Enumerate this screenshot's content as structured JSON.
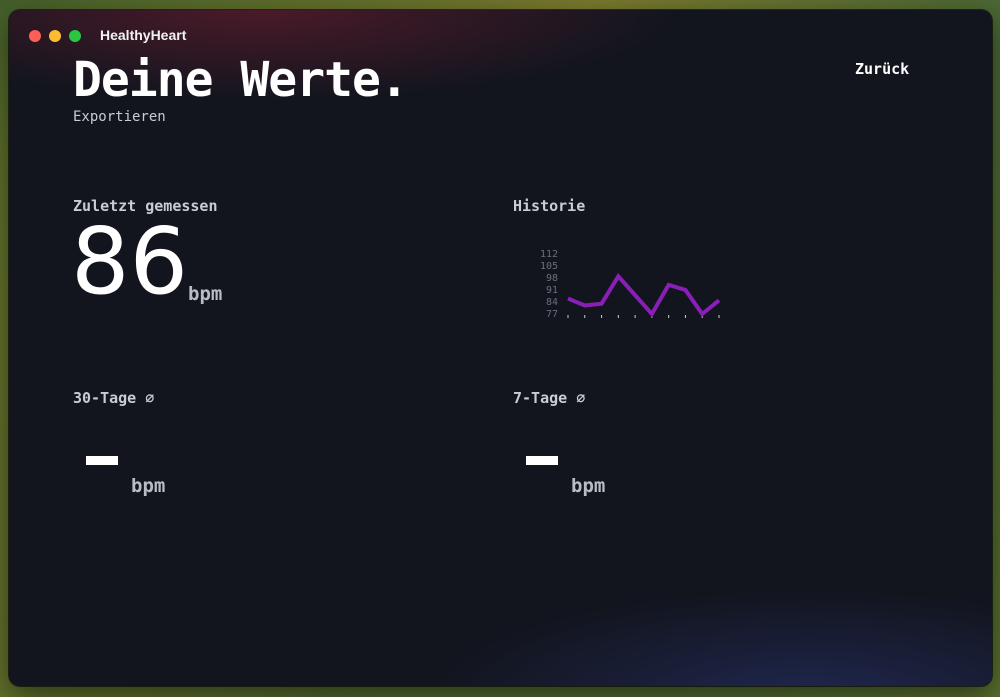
{
  "window": {
    "title": "HealthyHeart"
  },
  "header": {
    "title": "Deine Werte.",
    "export_label": "Exportieren",
    "back_label": "Zurück"
  },
  "latest": {
    "label": "Zuletzt gemessen",
    "value": "86",
    "unit": "bpm"
  },
  "history": {
    "label": "Historie"
  },
  "avg30": {
    "label": "30-Tage ⌀",
    "unit": "bpm"
  },
  "avg7": {
    "label": "7-Tage ⌀",
    "unit": "bpm"
  },
  "colors": {
    "accent": "#8a1fb8",
    "background": "#12151e"
  },
  "chart_data": {
    "type": "line",
    "x": [
      1,
      2,
      3,
      4,
      5,
      6,
      7,
      8,
      9,
      10
    ],
    "series": [
      {
        "values": [
          86,
          82,
          83,
          99,
          88,
          77,
          94,
          91,
          77,
          85
        ]
      }
    ],
    "yticks": [
      "112",
      "105",
      "98",
      "91",
      "84",
      "77"
    ],
    "ylim": [
      77,
      112
    ],
    "xlabel": "",
    "ylabel": "",
    "title": "",
    "grid": false
  }
}
